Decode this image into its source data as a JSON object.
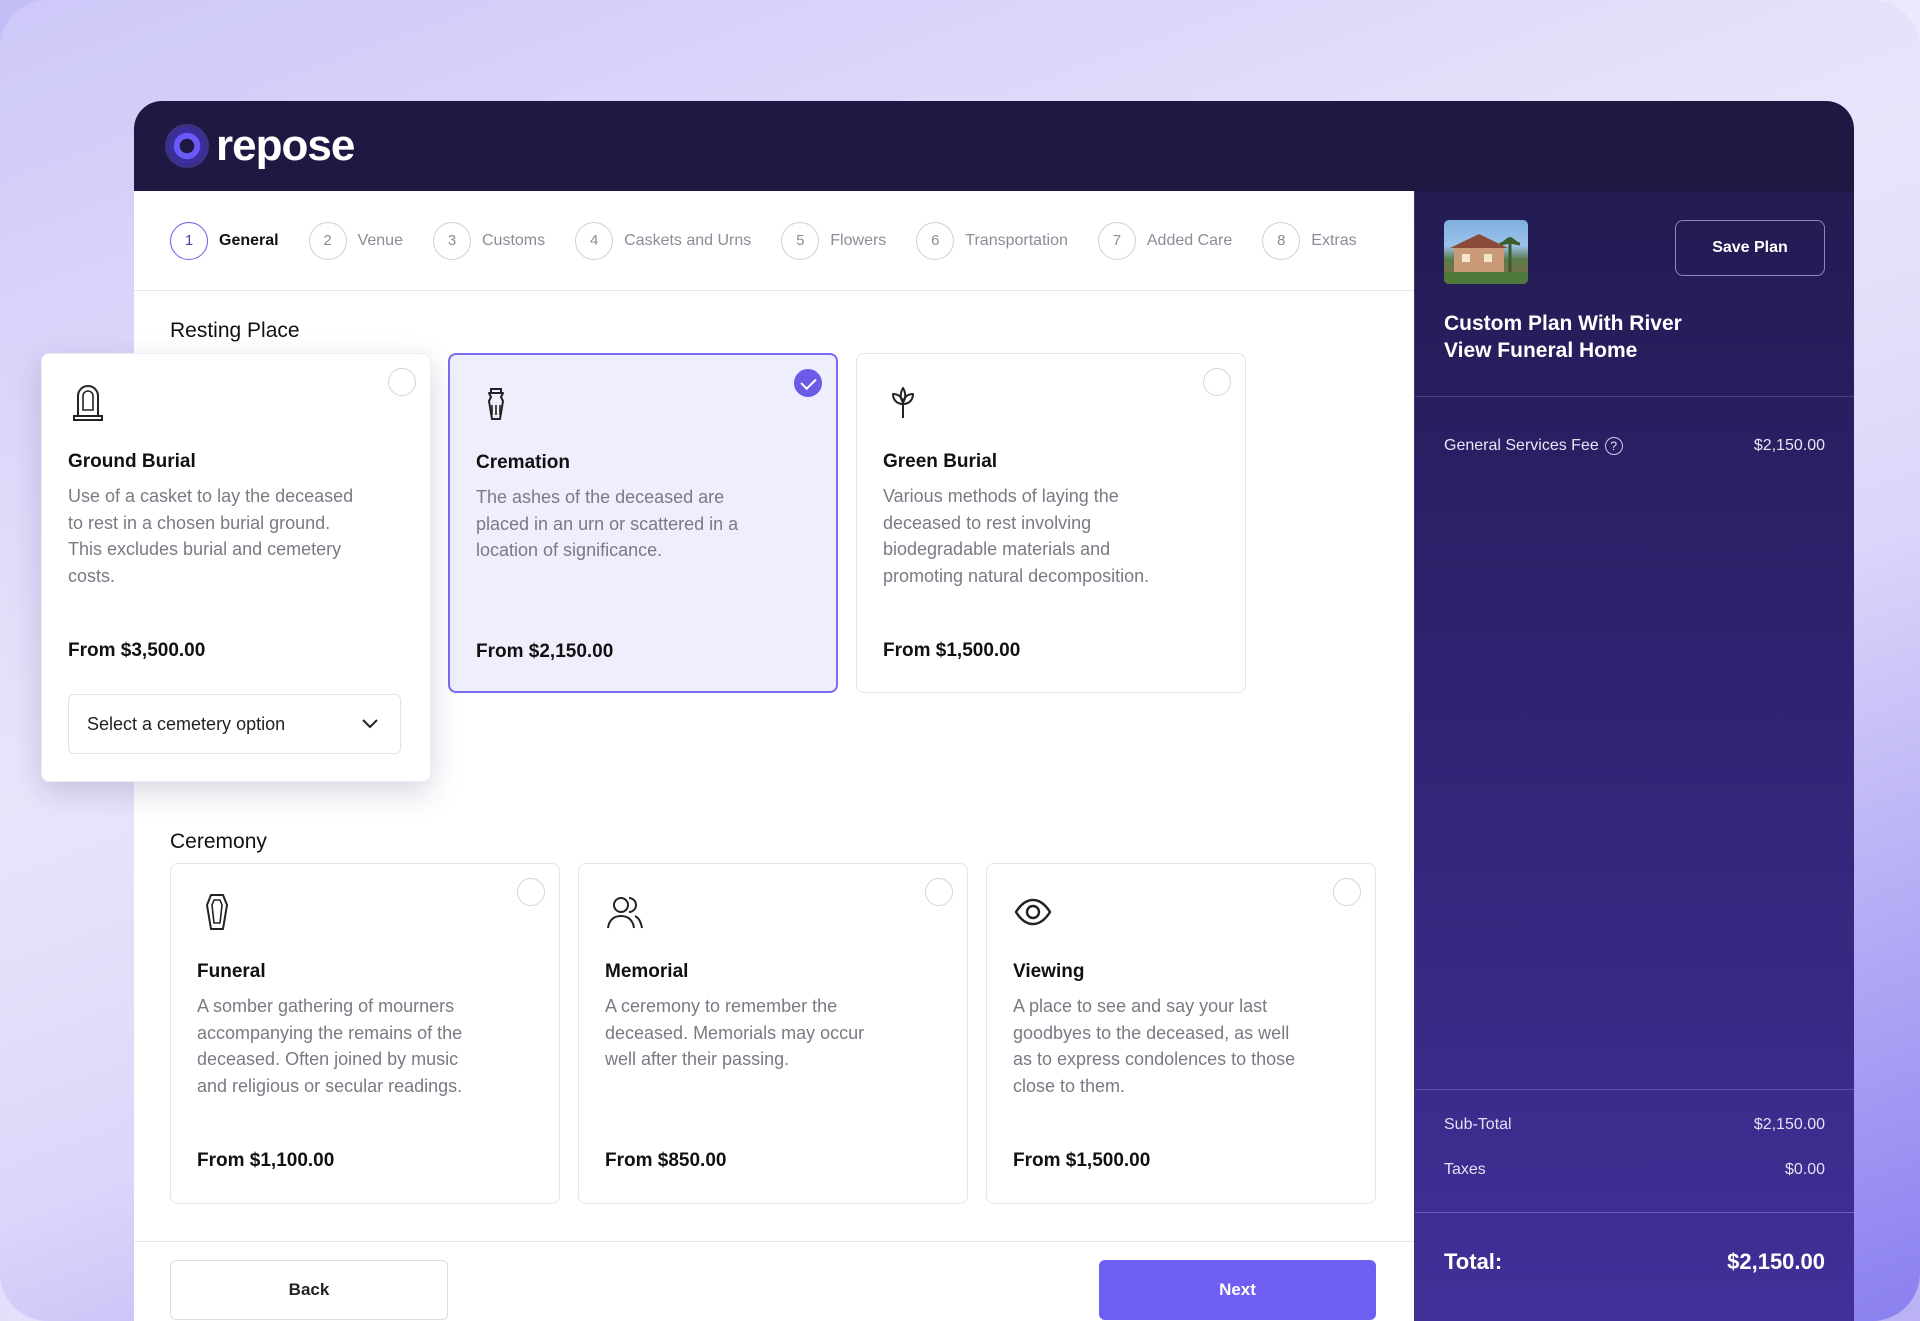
{
  "brand": {
    "name": "repose"
  },
  "steps": [
    {
      "num": "1",
      "label": "General",
      "active": true
    },
    {
      "num": "2",
      "label": "Venue"
    },
    {
      "num": "3",
      "label": "Customs"
    },
    {
      "num": "4",
      "label": "Caskets and Urns"
    },
    {
      "num": "5",
      "label": "Flowers"
    },
    {
      "num": "6",
      "label": "Transportation"
    },
    {
      "num": "7",
      "label": "Added Care"
    },
    {
      "num": "8",
      "label": "Extras"
    }
  ],
  "resting_place": {
    "title": "Resting Place",
    "options": [
      {
        "icon": "headstone-icon",
        "title": "Ground Burial",
        "desc": "Use of a casket to lay the deceased to rest in a chosen burial ground. This excludes burial and cemetery costs.",
        "price": "From $3,500.00",
        "selected": false,
        "select_label": "Select a cemetery option"
      },
      {
        "icon": "urn-icon",
        "title": "Cremation",
        "desc": "The ashes of the deceased are placed in an urn or scattered in a location of significance.",
        "price": "From $2,150.00",
        "selected": true
      },
      {
        "icon": "sprout-icon",
        "title": "Green Burial",
        "desc": "Various methods of laying the deceased to rest involving biodegradable materials and promoting natural decomposition.",
        "price": "From $1,500.00",
        "selected": false
      }
    ]
  },
  "ceremony": {
    "title": "Ceremony",
    "options": [
      {
        "icon": "coffin-icon",
        "title": "Funeral",
        "desc": "A somber gathering of mourners accompanying the remains of the deceased. Often joined by music and religious or secular readings.",
        "price": "From $1,100.00",
        "selected": false
      },
      {
        "icon": "people-icon",
        "title": "Memorial",
        "desc": "A ceremony to remember the deceased. Memorials may occur well after their passing.",
        "price": "From $850.00",
        "selected": false
      },
      {
        "icon": "eye-icon",
        "title": "Viewing",
        "desc": "A place to see and say your last goodbyes to the deceased, as well as to express condolences to those close to them.",
        "price": "From $1,500.00",
        "selected": false
      }
    ]
  },
  "footer": {
    "back_label": "Back",
    "next_label": "Next"
  },
  "summary": {
    "save_label": "Save Plan",
    "plan_title": "Custom Plan With River View Funeral Home",
    "fee_label": "General Services Fee",
    "fee_value": "$2,150.00",
    "subtotal_label": "Sub-Total",
    "subtotal_value": "$2,150.00",
    "taxes_label": "Taxes",
    "taxes_value": "$0.00",
    "total_label": "Total:",
    "total_value": "$2,150.00"
  },
  "colors": {
    "accent": "#6e5ff2",
    "header": "#1e1842",
    "selected_bg": "#efeefd"
  }
}
